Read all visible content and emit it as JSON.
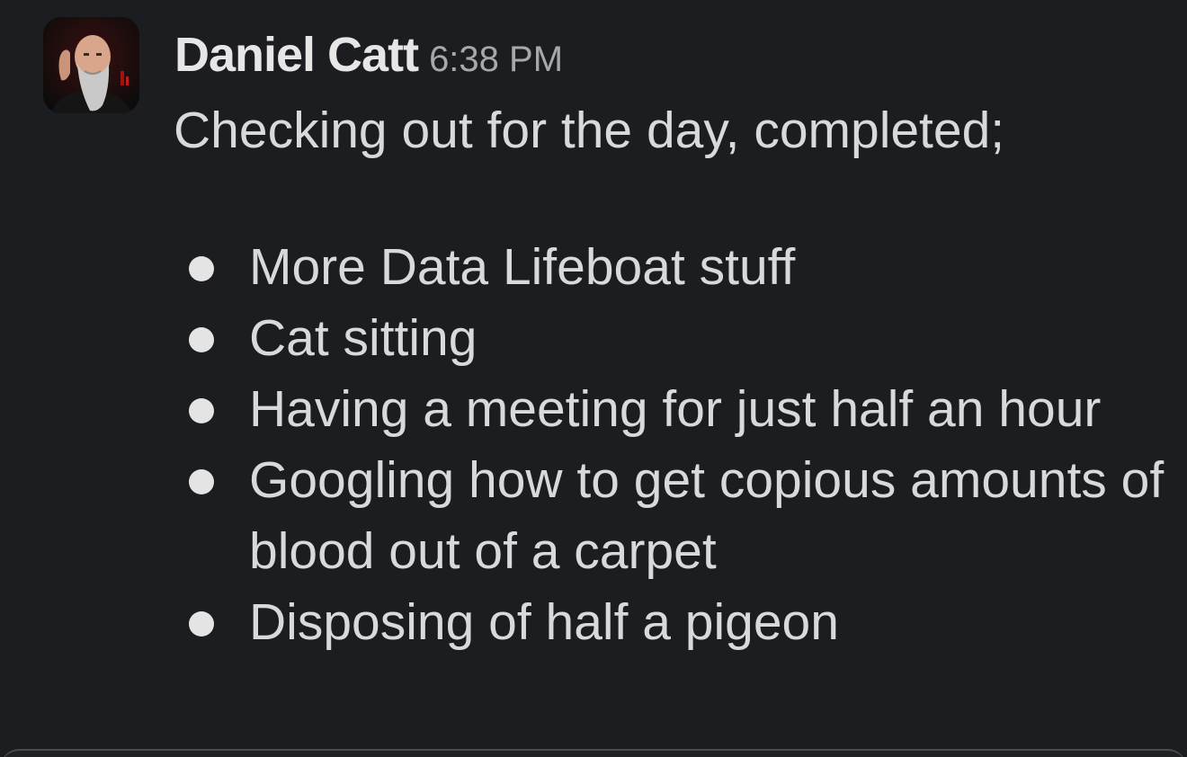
{
  "message": {
    "sender": "Daniel Catt",
    "timestamp": "6:38 PM",
    "intro": "Checking out for the day, completed;",
    "bullets": [
      "More Data Lifeboat stuff",
      "Cat sitting",
      "Having a meeting for just half an hour",
      "Googling how to get copious amounts of blood out of a carpet",
      "Disposing of half a pigeon"
    ]
  },
  "avatar": {
    "icon": "bearded-man-photo"
  },
  "colors": {
    "background": "#1b1d21",
    "sender_text": "#e6e6e6",
    "body_text": "#d8d9da",
    "timestamp_text": "#a7a8aa"
  }
}
